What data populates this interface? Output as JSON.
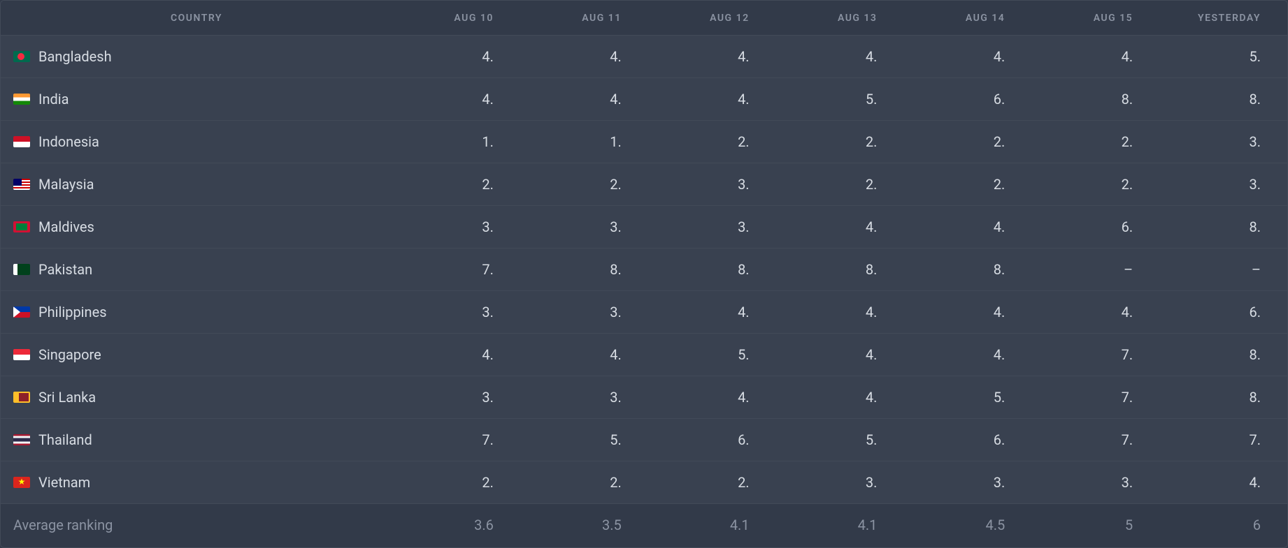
{
  "columns": {
    "country": "COUNTRY",
    "dates": [
      "AUG 10",
      "AUG 11",
      "AUG 12",
      "AUG 13",
      "AUG 14",
      "AUG 15",
      "YESTERDAY"
    ]
  },
  "rows": [
    {
      "flag": "bangladesh",
      "country": "Bangladesh",
      "values": [
        "4.",
        "4.",
        "4.",
        "4.",
        "4.",
        "4.",
        "5."
      ]
    },
    {
      "flag": "india",
      "country": "India",
      "values": [
        "4.",
        "4.",
        "4.",
        "5.",
        "6.",
        "8.",
        "8."
      ]
    },
    {
      "flag": "indonesia",
      "country": "Indonesia",
      "values": [
        "1.",
        "1.",
        "2.",
        "2.",
        "2.",
        "2.",
        "3."
      ]
    },
    {
      "flag": "malaysia",
      "country": "Malaysia",
      "values": [
        "2.",
        "2.",
        "3.",
        "2.",
        "2.",
        "2.",
        "3."
      ]
    },
    {
      "flag": "maldives",
      "country": "Maldives",
      "values": [
        "3.",
        "3.",
        "3.",
        "4.",
        "4.",
        "6.",
        "8."
      ]
    },
    {
      "flag": "pakistan",
      "country": "Pakistan",
      "values": [
        "7.",
        "8.",
        "8.",
        "8.",
        "8.",
        "–",
        "–"
      ]
    },
    {
      "flag": "philippines",
      "country": "Philippines",
      "values": [
        "3.",
        "3.",
        "4.",
        "4.",
        "4.",
        "4.",
        "6."
      ]
    },
    {
      "flag": "singapore",
      "country": "Singapore",
      "values": [
        "4.",
        "4.",
        "5.",
        "4.",
        "4.",
        "7.",
        "8."
      ]
    },
    {
      "flag": "srilanka",
      "country": "Sri Lanka",
      "values": [
        "3.",
        "3.",
        "4.",
        "4.",
        "5.",
        "7.",
        "8."
      ]
    },
    {
      "flag": "thailand",
      "country": "Thailand",
      "values": [
        "7.",
        "5.",
        "6.",
        "5.",
        "6.",
        "7.",
        "7."
      ]
    },
    {
      "flag": "vietnam",
      "country": "Vietnam",
      "values": [
        "2.",
        "2.",
        "2.",
        "3.",
        "3.",
        "3.",
        "4."
      ]
    }
  ],
  "footer": {
    "label": "Average ranking",
    "values": [
      "3.6",
      "3.5",
      "4.1",
      "4.1",
      "4.5",
      "5",
      "6"
    ]
  }
}
